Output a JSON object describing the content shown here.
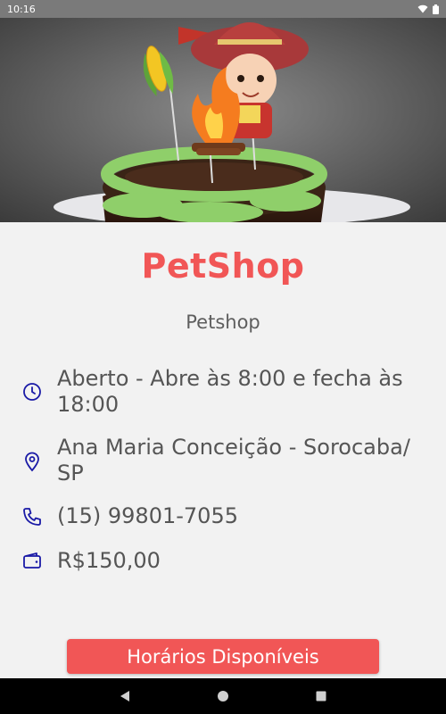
{
  "status_bar": {
    "time": "10:16"
  },
  "place": {
    "name": "PetShop",
    "category": "Petshop",
    "hours": "Aberto - Abre às 8:00 e fecha às 18:00",
    "address": "Ana Maria Conceição - Sorocaba/ SP",
    "phone": "(15) 99801-7055",
    "price": "R$150,00"
  },
  "actions": {
    "available_times_label": "Horários Disponíveis"
  },
  "colors": {
    "accent": "#f15656",
    "icon": "#1a1aa6",
    "text": "#555555"
  },
  "icons": {
    "hours": "clock-icon",
    "address": "location-pin-icon",
    "phone": "phone-icon",
    "price": "wallet-icon"
  }
}
